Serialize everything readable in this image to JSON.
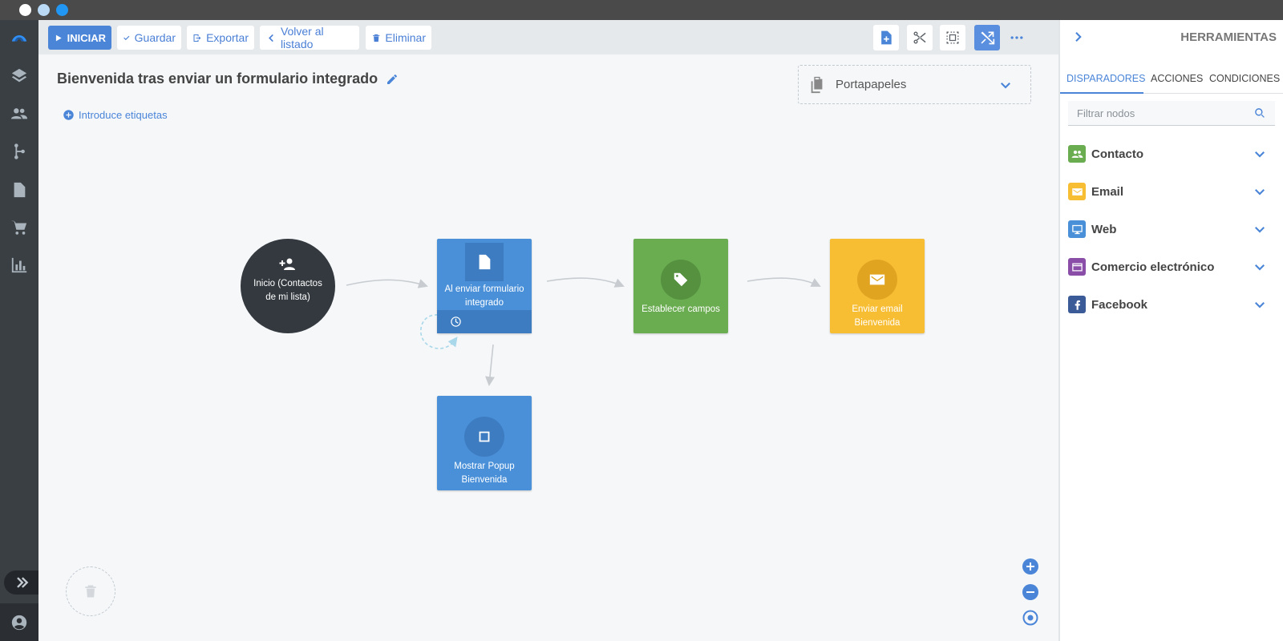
{
  "toolbar": {
    "start_label": "INICIAR",
    "save_label": "Guardar",
    "export_label": "Exportar",
    "back_label": "Volver al listado",
    "delete_label": "Eliminar"
  },
  "flow": {
    "title": "Bienvenida tras enviar un formulario integrado",
    "tags_link": "Introduce etiquetas",
    "clipboard_label": "Portapapeles"
  },
  "nodes": {
    "start": "Inicio (Contactos de mi lista)",
    "trigger": "Al enviar formulario integrado",
    "set_fields": "Establecer campos",
    "send_email": "Enviar email Bienvenida",
    "popup": "Mostrar Popup Bienvenida"
  },
  "panel": {
    "title": "HERRAMIENTAS",
    "tabs": [
      "DISPARADORES",
      "ACCIONES",
      "CONDICIONES"
    ],
    "filter_placeholder": "Filtrar nodos",
    "categories": [
      "Contacto",
      "Email",
      "Web",
      "Comercio electrónico",
      "Facebook"
    ]
  },
  "colors": {
    "primary": "#4a85d8",
    "trigger": "#4a90d9",
    "action_green": "#6aac50",
    "email_yellow": "#f7bd33",
    "start_dark": "#33393f"
  },
  "icons": {
    "start": "user-plus-icon",
    "trigger": "document-icon",
    "set_fields": "tag-icon",
    "send_email": "mail-icon",
    "popup": "square-icon"
  }
}
